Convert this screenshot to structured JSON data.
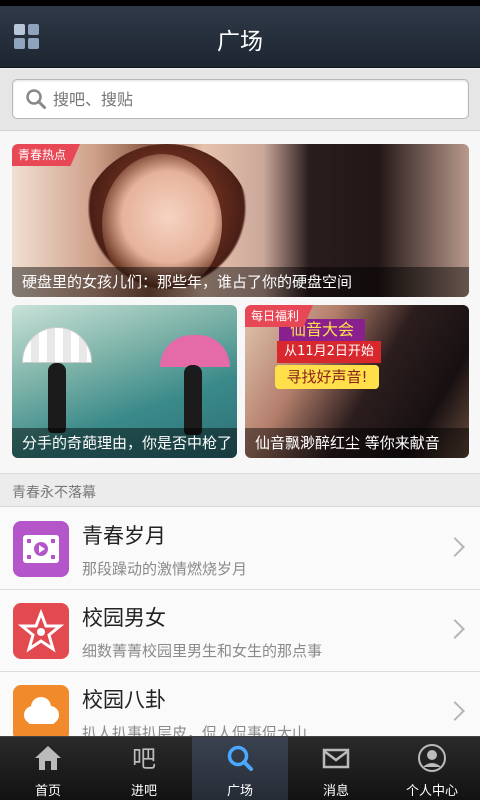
{
  "header": {
    "title": "广场",
    "menu_icon": "grid-icon"
  },
  "search": {
    "placeholder": "搜吧、搜贴",
    "icon": "search-icon"
  },
  "featured": {
    "main": {
      "tag": "青春热点",
      "caption": "硬盘里的女孩儿们：那些年，谁占了你的硬盘空间"
    },
    "left": {
      "caption": "分手的奇葩理由，你是否中枪了"
    },
    "right": {
      "tag": "每日福利",
      "caption": "仙音飘渺醉红尘 等你来献音",
      "banner_line1": "仙音大会",
      "banner_line2": "从11月2日开始",
      "banner_line3": "寻找好声音!"
    }
  },
  "section": {
    "title": "青春永不落幕"
  },
  "list": [
    {
      "title": "青春岁月",
      "desc": "那段躁动的激情燃烧岁月",
      "icon": "film-icon",
      "color": "#b455c9"
    },
    {
      "title": "校园男女",
      "desc": "细数菁菁校园里男生和女生的那点事",
      "icon": "star-icon",
      "color": "#e24a4f"
    },
    {
      "title": "校园八卦",
      "desc": "扒人扒事扒层皮，侃人侃事侃大山",
      "icon": "cloud-icon",
      "color": "#f08a2a"
    }
  ],
  "tabs": [
    {
      "label": "首页",
      "icon": "home-icon"
    },
    {
      "label": "进吧",
      "icon": "ba-icon"
    },
    {
      "label": "广场",
      "icon": "search-icon",
      "active": true
    },
    {
      "label": "消息",
      "icon": "mail-icon"
    },
    {
      "label": "个人中心",
      "icon": "user-icon"
    }
  ]
}
